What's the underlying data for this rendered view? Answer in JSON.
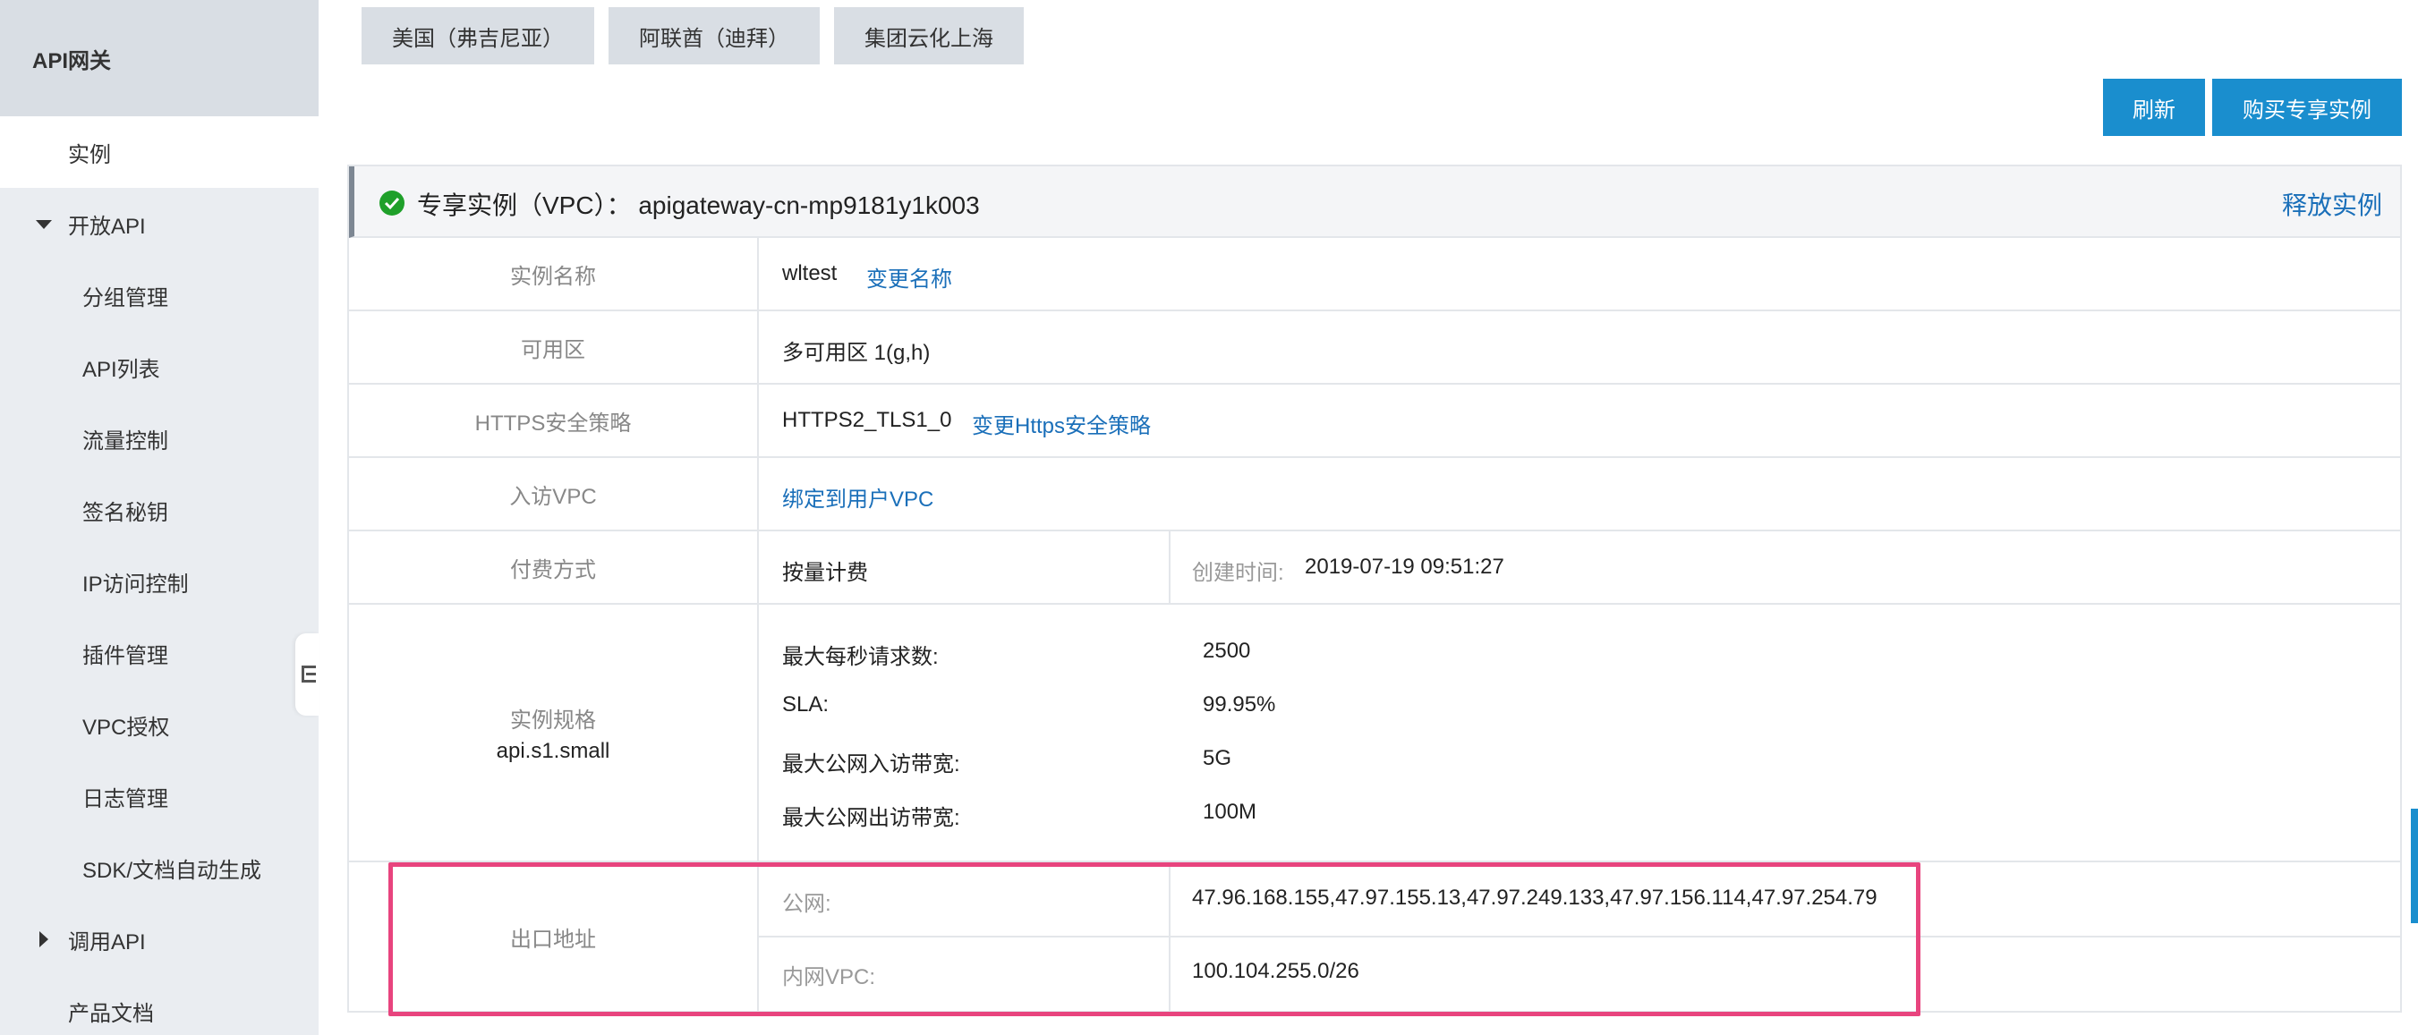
{
  "sidebar": {
    "title": "API网关",
    "items": [
      {
        "label": "实例"
      },
      {
        "label": "开放API"
      },
      {
        "label": "分组管理"
      },
      {
        "label": "API列表"
      },
      {
        "label": "流量控制"
      },
      {
        "label": "签名秘钥"
      },
      {
        "label": "IP访问控制"
      },
      {
        "label": "插件管理"
      },
      {
        "label": "VPC授权"
      },
      {
        "label": "日志管理"
      },
      {
        "label": "SDK/文档自动生成"
      },
      {
        "label": "调用API"
      },
      {
        "label": "产品文档"
      }
    ]
  },
  "regions": [
    "美国（弗吉尼亚）",
    "阿联酋（迪拜）",
    "集团云化上海"
  ],
  "actions": {
    "refresh": "刷新",
    "buy": "购买专享实例"
  },
  "instance": {
    "header": "专享实例（VPC）： apigateway-cn-mp9181y1k003",
    "release": "释放实例",
    "name_label": "实例名称",
    "name_value": "wltest",
    "rename": "变更名称",
    "zone_label": "可用区",
    "zone_value": "多可用区 1(g,h)",
    "https_label": "HTTPS安全策略",
    "https_value": "HTTPS2_TLS1_0",
    "https_change": "变更Https安全策略",
    "vpc_label": "入访VPC",
    "vpc_bind": "绑定到用户VPC",
    "billing_label": "付费方式",
    "billing_value": "按量计费",
    "created_label": "创建时间:",
    "created_value": "2019-07-19 09:51:27",
    "spec_label": "实例规格",
    "spec_value": "api.s1.small",
    "specs": [
      {
        "key": "最大每秒请求数:",
        "value": "2500"
      },
      {
        "key": "SLA:",
        "value": "99.95%"
      },
      {
        "key": "最大公网入访带宽:",
        "value": "5G"
      },
      {
        "key": "最大公网出访带宽:",
        "value": "100M"
      }
    ],
    "egress_label": "出口地址",
    "public_label": "公网:",
    "public_value": "47.96.168.155,47.97.155.13,47.97.249.133,47.97.156.114,47.97.254.79",
    "vpc_internal_label": "内网VPC:",
    "vpc_internal_value": "100.104.255.0/26"
  }
}
